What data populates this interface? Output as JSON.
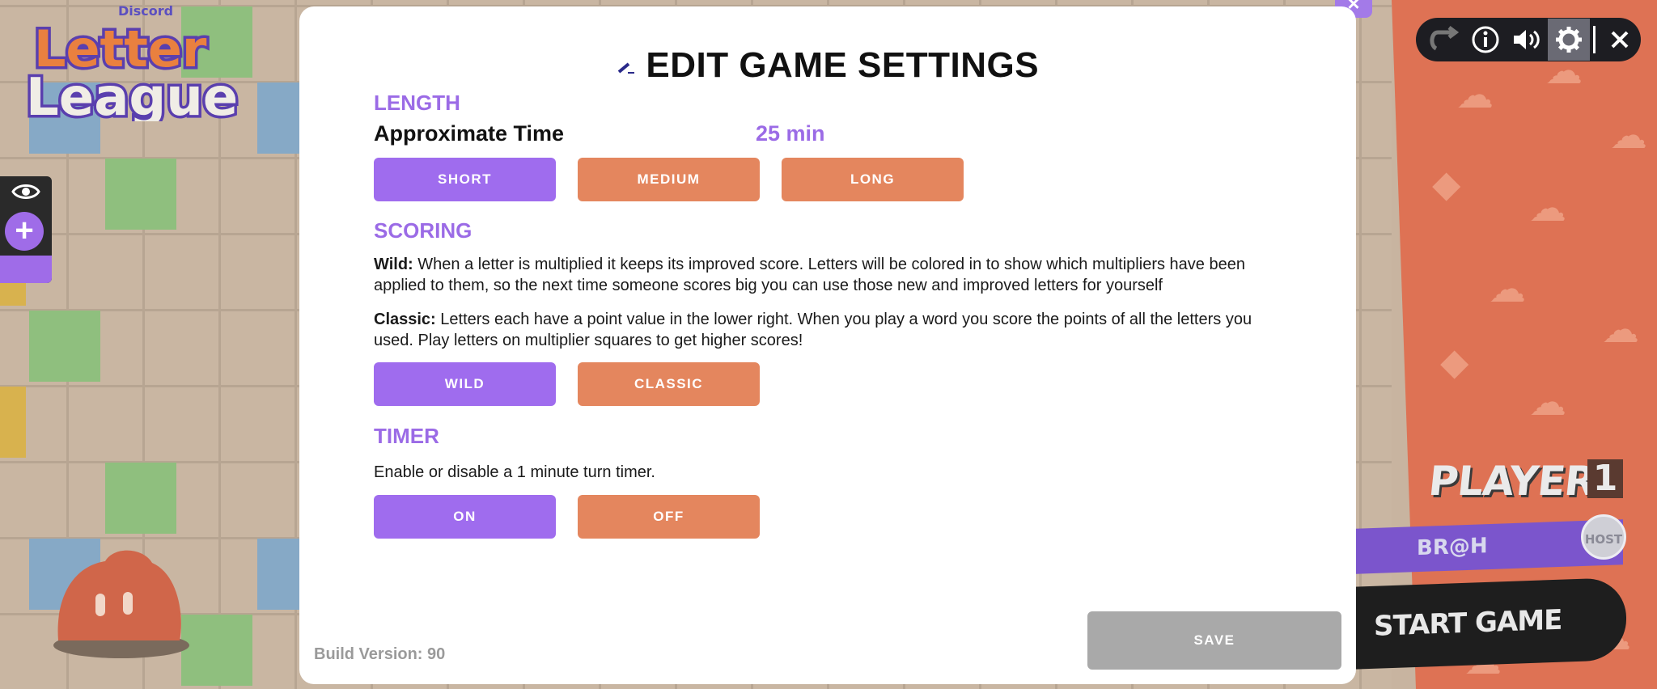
{
  "app": {
    "platform_label": "Discord",
    "logo_line1": "Letter",
    "logo_line2": "League"
  },
  "modal": {
    "title": "EDIT GAME SETTINGS",
    "length": {
      "heading": "LENGTH",
      "approx_label": "Approximate Time",
      "approx_value": "25 min",
      "options": [
        {
          "label": "SHORT",
          "selected": true
        },
        {
          "label": "MEDIUM",
          "selected": false
        },
        {
          "label": "LONG",
          "selected": false
        }
      ]
    },
    "scoring": {
      "heading": "SCORING",
      "wild_term": "Wild:",
      "wild_text": "When a letter is multiplied it keeps its improved score. Letters will be colored in to show which multipliers have been applied to them, so the next time someone scores big you can use those new and improved letters for yourself",
      "classic_term": "Classic:",
      "classic_text": "Letters each have a point value in the lower right. When you play a word you score the points of all the letters you used. Play letters on multiplier squares to get higher scores!",
      "options": [
        {
          "label": "WILD",
          "selected": true
        },
        {
          "label": "CLASSIC",
          "selected": false
        }
      ]
    },
    "timer": {
      "heading": "TIMER",
      "description": "Enable or disable a 1 minute turn timer.",
      "options": [
        {
          "label": "ON",
          "selected": true
        },
        {
          "label": "OFF",
          "selected": false
        }
      ]
    },
    "build_version": "Build Version: 90",
    "save_label": "SAVE",
    "close_glyph": "×"
  },
  "sidebar": {
    "players_label": "PLAYERS",
    "players_count": "1",
    "player_name": "BR@H",
    "host_badge": "HOST",
    "start_game_label": "START GAME"
  },
  "toolbar": {
    "icons": [
      "reset-icon",
      "info-icon",
      "volume-icon",
      "settings-icon",
      "close-icon"
    ],
    "active": "settings-icon"
  },
  "colors": {
    "accent_purple": "#9f6cee",
    "accent_orange": "#e4865e",
    "panel_orange": "#de7254",
    "save_disabled": "#a9a9a9"
  }
}
